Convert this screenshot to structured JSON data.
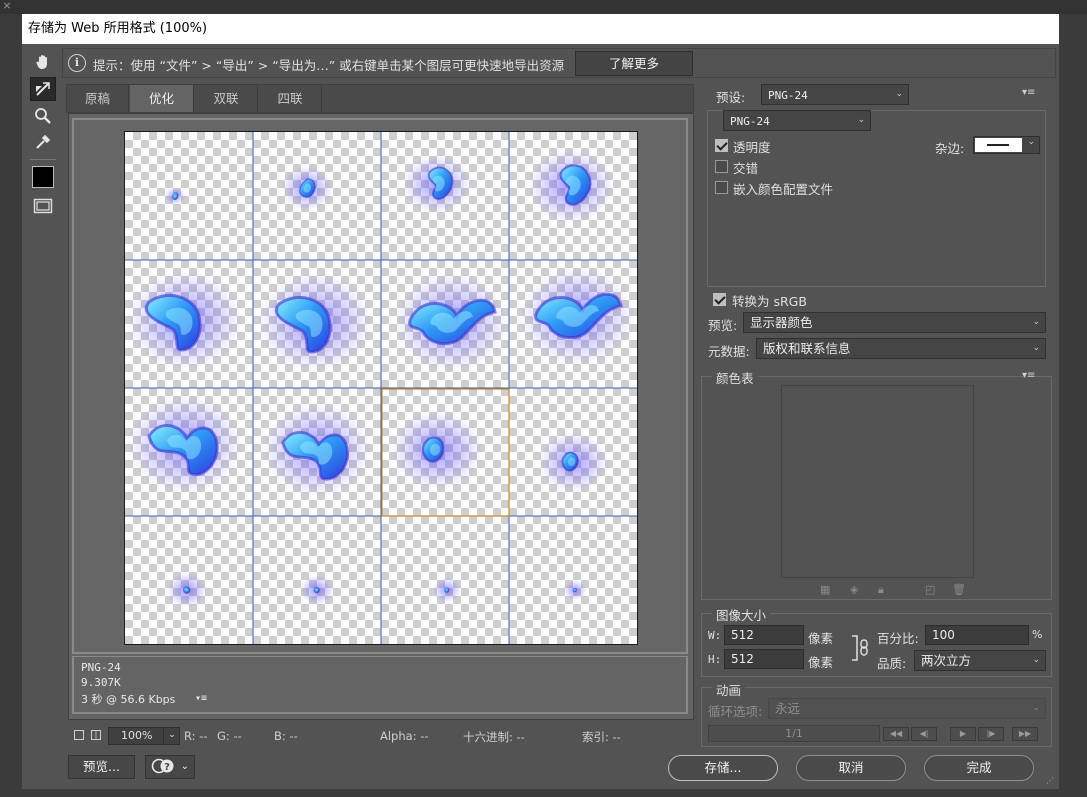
{
  "window": {
    "title": "存储为 Web 所用格式 (100%)",
    "close_glyph": "×"
  },
  "hint": {
    "text": "提示：使用 “文件” > “导出” > “导出为…” 或右键单击某个图层可更快速地导出资源",
    "learn_more": "了解更多"
  },
  "tabs": [
    {
      "label": "原稿",
      "active": false
    },
    {
      "label": "优化",
      "active": true
    },
    {
      "label": "双联",
      "active": false
    },
    {
      "label": "四联",
      "active": false
    }
  ],
  "preview": {
    "format": "PNG-24",
    "size": "9.307K",
    "time": "3 秒 @ 56.6 Kbps",
    "menu_glyph": "▾≡"
  },
  "status": {
    "zoom": "100%",
    "r": "R: --",
    "g": "G: --",
    "b": "B: --",
    "alpha": "Alpha: --",
    "hex": "十六进制: --",
    "index": "索引: --"
  },
  "buttons": {
    "preview": "预览...",
    "save": "存储...",
    "cancel": "取消",
    "done": "完成"
  },
  "settings": {
    "preset_label": "预设:",
    "preset_value": "PNG-24",
    "format_value": "PNG-24",
    "transparency": {
      "label": "透明度",
      "checked": true
    },
    "interlaced": {
      "label": "交错",
      "checked": false
    },
    "embed_profile": {
      "label": "嵌入颜色配置文件",
      "checked": false
    },
    "matte_label": "杂边:",
    "convert_srgb": {
      "label": "转换为 sRGB",
      "checked": true
    },
    "preview_label": "预览:",
    "preview_value": "显示器颜色",
    "metadata_label": "元数据:",
    "metadata_value": "版权和联系信息"
  },
  "color_table": {
    "title": "颜色表"
  },
  "image_size": {
    "title": "图像大小",
    "w_label": "W:",
    "w_value": "512",
    "h_label": "H:",
    "h_value": "512",
    "unit": "像素",
    "percent_label": "百分比:",
    "percent_value": "100",
    "percent_sign": "%",
    "quality_label": "品质:",
    "quality_value": "两次立方"
  },
  "animation": {
    "title": "动画",
    "loop_label": "循环选项:",
    "loop_value": "永远",
    "frame": "1/1"
  },
  "colors": {
    "selection": "#c88a1a",
    "grid": "#3b5fb8",
    "flame_core": "#7fe9ff",
    "flame_mid": "#2f86f0",
    "flame_outer": "#3d2fd8"
  }
}
